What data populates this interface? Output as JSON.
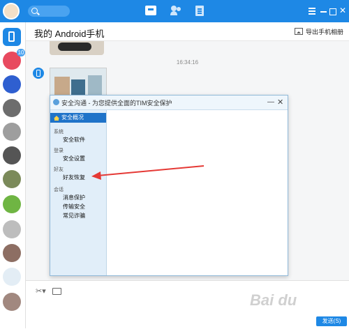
{
  "chat": {
    "title": "我的 Android手机",
    "export_label": "导出手机相册",
    "timestamp": "16:34:16"
  },
  "sidebar": {
    "badge_count": "10"
  },
  "dialog": {
    "title": "安全沟通 - 为您提供全面的TIM安全保护",
    "minimize": "—",
    "close": "✕",
    "nav": {
      "selected": "安全概况",
      "groups": [
        {
          "label": "系统",
          "items": [
            "安全软件"
          ]
        },
        {
          "label": "登录",
          "items": [
            "安全设置"
          ]
        },
        {
          "label": "好友",
          "items": [
            "好友恢复"
          ]
        },
        {
          "label": "会话",
          "items": [
            "消息保护",
            "传输安全",
            "常见诈骗"
          ]
        }
      ]
    }
  },
  "input": {
    "send_label": "发送(S)"
  },
  "colors": {
    "titlebar": "#1e88e5",
    "dialog_selected": "#1f73c9",
    "arrow": "#e53935"
  }
}
